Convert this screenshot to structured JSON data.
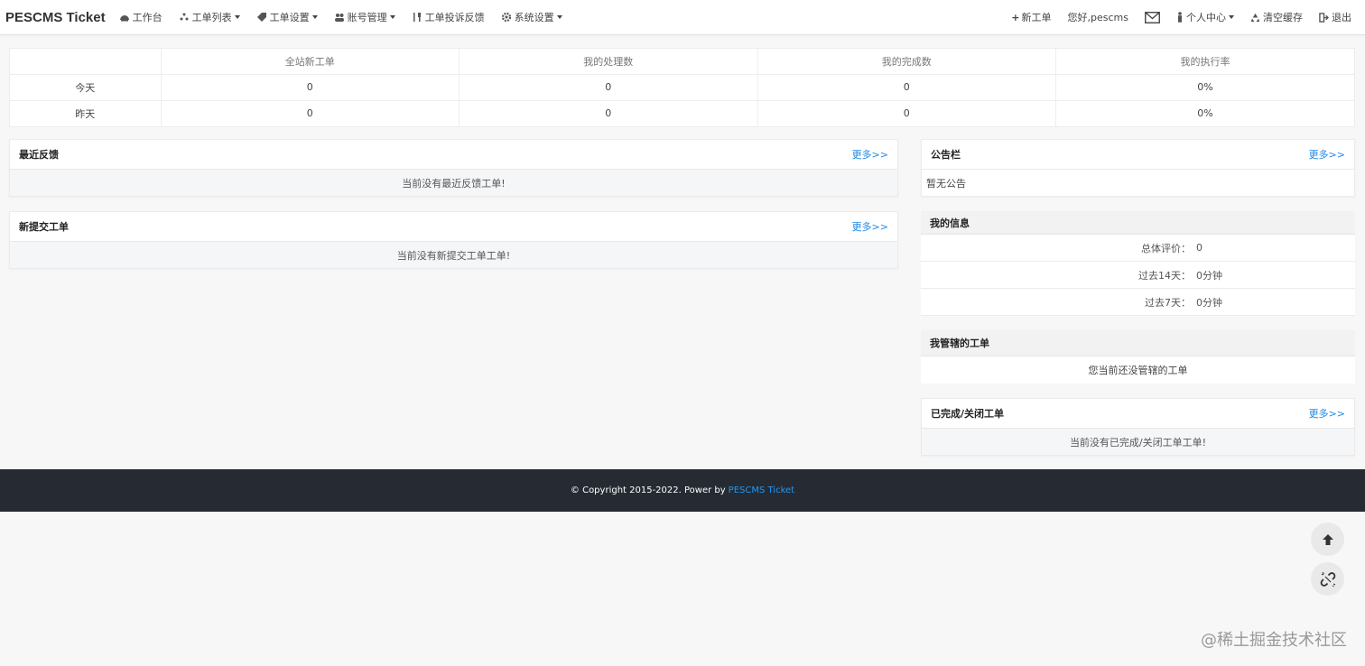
{
  "brand": "PESCMS Ticket",
  "nav": {
    "items": [
      {
        "label": "工作台",
        "icon": "dashboard-icon",
        "caret": false
      },
      {
        "label": "工单列表",
        "icon": "list-icon",
        "caret": true
      },
      {
        "label": "工单设置",
        "icon": "tag-icon",
        "caret": true
      },
      {
        "label": "账号管理",
        "icon": "users-icon",
        "caret": true
      },
      {
        "label": "工单投诉反馈",
        "icon": "cutlery-icon",
        "caret": false
      },
      {
        "label": "系统设置",
        "icon": "gear-icon",
        "caret": true
      }
    ],
    "right": {
      "new_ticket": "新工单",
      "greeting": "您好,pescms",
      "personal": "个人中心",
      "clear_cache": "清空缓存",
      "logout": "退出"
    }
  },
  "stats": {
    "headers": [
      "",
      "全站新工单",
      "我的处理数",
      "我的完成数",
      "我的执行率"
    ],
    "rows": [
      [
        "今天",
        "0",
        "0",
        "0",
        "0%"
      ],
      [
        "昨天",
        "0",
        "0",
        "0",
        "0%"
      ]
    ]
  },
  "recent_feedback": {
    "title": "最近反馈",
    "more": "更多>>",
    "empty": "当前没有最近反馈工单!"
  },
  "new_submitted": {
    "title": "新提交工单",
    "more": "更多>>",
    "empty": "当前没有新提交工单工单!"
  },
  "notice": {
    "title": "公告栏",
    "more": "更多>>",
    "body": "暂无公告"
  },
  "my_info": {
    "title": "我的信息",
    "rows": [
      {
        "k": "总体评价：",
        "v": "0"
      },
      {
        "k": "过去14天：",
        "v": "0分钟"
      },
      {
        "k": "过去7天：",
        "v": "0分钟"
      }
    ]
  },
  "managed": {
    "title": "我管辖的工单",
    "body": "您当前还没管辖的工单"
  },
  "closed": {
    "title": "已完成/关闭工单",
    "more": "更多>>",
    "empty": "当前没有已完成/关闭工单工单!"
  },
  "footer": {
    "text": "© Copyright 2015-2022. Power by",
    "link": "PESCMS Ticket"
  },
  "watermark": "@稀土掘金技术社区"
}
